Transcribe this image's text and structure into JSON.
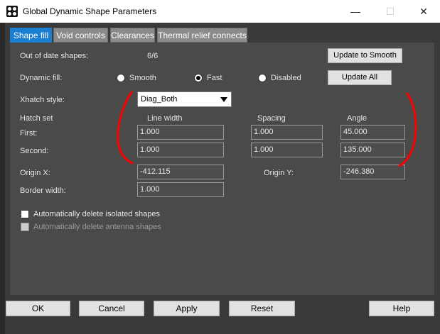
{
  "window": {
    "title": "Global Dynamic Shape Parameters",
    "minimize": "—",
    "maximize": "☐",
    "close": "✕"
  },
  "tabs": [
    {
      "label": "Shape fill",
      "active": true
    },
    {
      "label": "Void controls",
      "active": false
    },
    {
      "label": "Clearances",
      "active": false
    },
    {
      "label": "Thermal relief connects",
      "active": false
    }
  ],
  "shape_fill": {
    "out_of_date_label": "Out of date shapes:",
    "out_of_date_value": "6/6",
    "update_smooth_button": "Update to Smooth",
    "dynamic_fill_label": "Dynamic fill:",
    "dynamic_fill_options": [
      "Smooth",
      "Fast",
      "Disabled"
    ],
    "dynamic_fill_selected": "Fast",
    "update_all_button": "Update All",
    "xhatch_label": "Xhatch style:",
    "xhatch_value": "Diag_Both",
    "hatch_set_label": "Hatch set",
    "col_line_width": "Line width",
    "col_spacing": "Spacing",
    "col_angle": "Angle",
    "first_label": "First:",
    "first": {
      "line_width": "1.000",
      "spacing": "1.000",
      "angle": "45.000"
    },
    "second_label": "Second:",
    "second": {
      "line_width": "1.000",
      "spacing": "1.000",
      "angle": "135.000"
    },
    "origin_x_label": "Origin X:",
    "origin_x": "-412.115",
    "origin_y_label": "Origin Y:",
    "origin_y": "-246.380",
    "border_width_label": "Border width:",
    "border_width": "1.000",
    "auto_delete_isolated": "Automatically delete isolated shapes",
    "auto_delete_antenna": "Automatically delete antenna shapes"
  },
  "buttons": {
    "ok": "OK",
    "cancel": "Cancel",
    "apply": "Apply",
    "reset": "Reset",
    "help": "Help"
  },
  "colors": {
    "active_tab": "#1a7fd0",
    "annotation": "#ff0000"
  }
}
